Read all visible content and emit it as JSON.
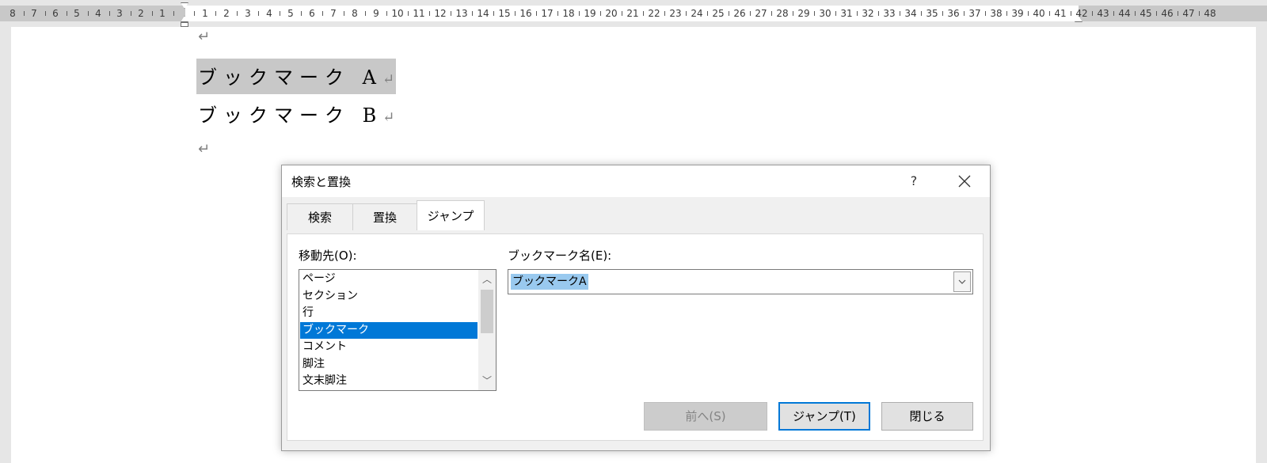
{
  "ruler": {
    "left_numbers": [
      "8",
      "7",
      "6",
      "5",
      "4",
      "3",
      "2",
      "1"
    ],
    "right_numbers": [
      "1",
      "2",
      "3",
      "4",
      "5",
      "6",
      "7",
      "8",
      "9",
      "10",
      "11",
      "12",
      "13",
      "14",
      "15",
      "16",
      "17",
      "18",
      "19",
      "20",
      "21",
      "22",
      "23",
      "24",
      "25",
      "26",
      "27",
      "28",
      "29",
      "30",
      "31",
      "32",
      "33",
      "34",
      "35",
      "36",
      "37",
      "38",
      "39",
      "40",
      "41",
      "42",
      "43",
      "44",
      "45",
      "46",
      "47",
      "48"
    ]
  },
  "document": {
    "paragraph_mark": "↵",
    "line_a": "ブックマーク A",
    "line_b": "ブックマーク B"
  },
  "dialog": {
    "title": "検索と置換",
    "help": "?",
    "tabs": [
      {
        "label": "検索"
      },
      {
        "label": "置換"
      },
      {
        "label": "ジャンプ"
      }
    ],
    "active_tab": "ジャンプ",
    "goto_label": "移動先(O):",
    "goto_items": [
      "ページ",
      "セクション",
      "行",
      "ブックマーク",
      "コメント",
      "脚注",
      "文末脚注"
    ],
    "goto_selected": "ブックマーク",
    "bookmark_label": "ブックマーク名(E):",
    "bookmark_value": "ブックマークA",
    "buttons": {
      "previous": "前へ(S)",
      "goto": "ジャンプ(T)",
      "close": "閉じる"
    }
  },
  "colors": {
    "selection": "#0078d7",
    "text_highlight": "#99c9ef",
    "doc_selection": "#c8c8c8"
  }
}
